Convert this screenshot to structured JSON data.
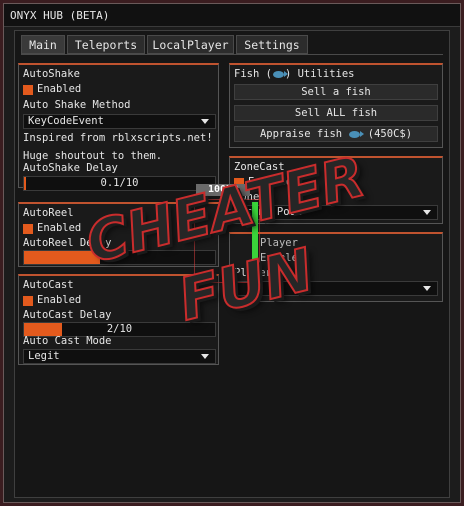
{
  "window": {
    "title": "ONYX HUB (BETA)"
  },
  "tabs": [
    {
      "label": "Main",
      "active": true
    },
    {
      "label": "Teleports"
    },
    {
      "label": "LocalPlayer"
    },
    {
      "label": "Settings"
    }
  ],
  "autoshake": {
    "title": "AutoShake",
    "enabled_label": "Enabled",
    "method_label": "Auto Shake Method",
    "method_value": "KeyCodeEvent",
    "credit_line1": "Inspired from rblxscripts.net!",
    "credit_line2": "Huge shoutout to them.",
    "delay_label": "AutoShake Delay",
    "delay_value": "0.1/10",
    "delay_fraction": 0.01
  },
  "autoreel": {
    "title": "AutoReel",
    "enabled_label": "Enabled",
    "delay_label": "AutoReel Delay",
    "delay_fraction": 0.4
  },
  "autocast": {
    "title": "AutoCast",
    "enabled_label": "Enabled",
    "delay_label": "AutoCast Delay",
    "delay_value": "2/10",
    "delay_fraction": 0.2,
    "mode_label": "Auto Cast Mode",
    "mode_value": "Legit"
  },
  "fish_utilities": {
    "title_pre": "Fish (",
    "title_post": ") Utilities",
    "sell_fish": "Sell a fish",
    "sell_all": "Sell ALL fish",
    "appraise_pre": "Appraise fish",
    "appraise_post": "(450C$)"
  },
  "zonecast": {
    "title": "ZoneCast",
    "enabled_label": "Enabled",
    "zone_label": "Zone",
    "zone_value": "Brine Pool"
  },
  "player_panel": {
    "row1": "Player",
    "row2": "Enabled",
    "player_label": "Player"
  },
  "overlay": {
    "hp_label": "100HP",
    "watermark_line1": "CHEATER",
    "watermark_line2": "FUN"
  },
  "colors": {
    "accent": "#e35a1d",
    "panel_header": "#c0532f",
    "hp_bar": "#3ad43a",
    "fish_icon": "#4a90b8"
  },
  "icons": [
    "fish-icon",
    "chevron-down-icon"
  ]
}
